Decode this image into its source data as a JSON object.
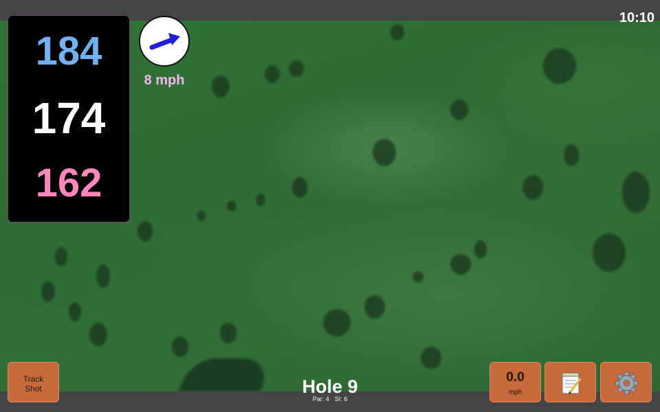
{
  "status": {
    "time": "10:10"
  },
  "distances": {
    "back": "184",
    "middle": "174",
    "front": "162"
  },
  "wind": {
    "speed": "8 mph",
    "icon": "wind-arrow-icon",
    "direction": "east-northeast"
  },
  "hole": {
    "title": "Hole 9",
    "par": "Par: 4",
    "stroke_index": "SI: 6"
  },
  "buttons": {
    "track_shot": [
      "Track",
      "Shot"
    ],
    "speed_value": "0.0",
    "speed_unit": "mph",
    "notes_icon": "notepad-icon",
    "settings_icon": "gear-icon"
  },
  "colors": {
    "back_distance": "#6fb1f3",
    "middle_distance": "#ffffff",
    "front_distance": "#ff87bd",
    "button": "#c8693c",
    "wind_text": "#f4b6f4"
  }
}
